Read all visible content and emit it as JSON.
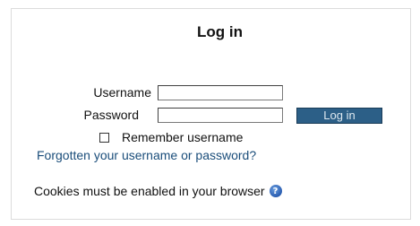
{
  "login": {
    "title": "Log in",
    "username_label": "Username",
    "username_value": "",
    "password_label": "Password",
    "password_value": "",
    "button_label": "Log in",
    "remember_label": "Remember username",
    "remember_checked": false,
    "forgot_link": "Forgotten your username or password?",
    "cookies_text": "Cookies must be enabled in your browser",
    "help_icon": "help-icon",
    "help_glyph": "?"
  },
  "colors": {
    "button_bg": "#2c5f87",
    "link": "#1a4d7a",
    "help_icon": "#2a5db0"
  }
}
